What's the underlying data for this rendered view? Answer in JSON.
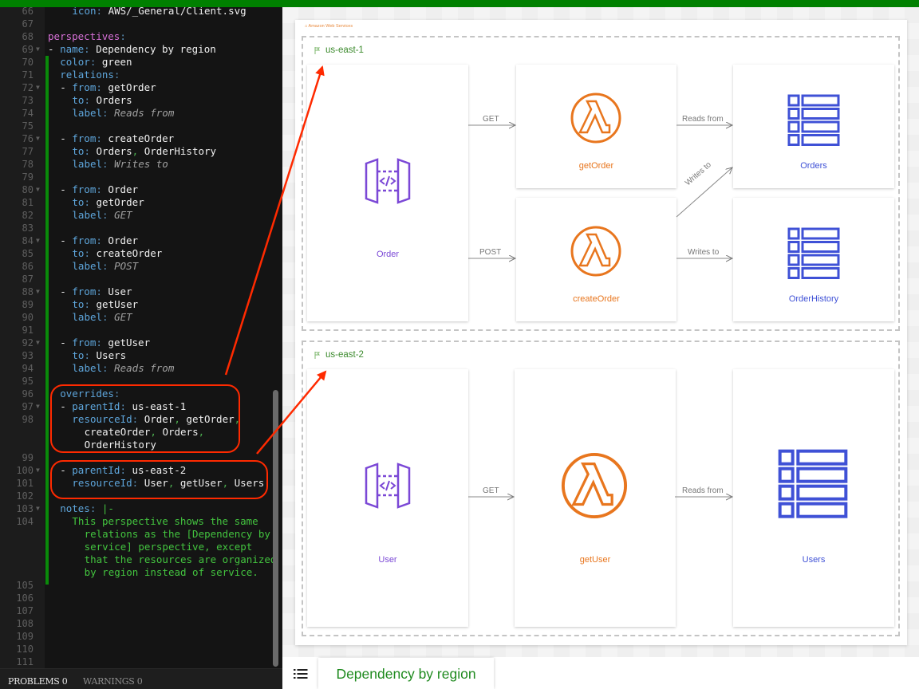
{
  "editor": {
    "lines": [
      {
        "n": "66",
        "fold": false,
        "indent": 4,
        "parts": [
          [
            "k",
            "icon"
          ],
          [
            "p",
            ": "
          ],
          [
            "v",
            "AWS/_General/Client.svg"
          ]
        ]
      },
      {
        "n": "67",
        "fold": false,
        "indent": 0,
        "parts": []
      },
      {
        "n": "68",
        "fold": false,
        "indent": 0,
        "parts": [
          [
            "k-mag",
            "perspectives"
          ],
          [
            "p",
            ":"
          ]
        ]
      },
      {
        "n": "69",
        "fold": true,
        "indent": 0,
        "parts": [
          [
            "v",
            "- "
          ],
          [
            "k",
            "name"
          ],
          [
            "p",
            ": "
          ],
          [
            "v",
            "Dependency by region"
          ]
        ]
      },
      {
        "n": "70",
        "fold": false,
        "indent": 2,
        "parts": [
          [
            "k",
            "color"
          ],
          [
            "p",
            ": "
          ],
          [
            "v",
            "green"
          ]
        ]
      },
      {
        "n": "71",
        "fold": false,
        "indent": 2,
        "parts": [
          [
            "k",
            "relations"
          ],
          [
            "p",
            ":"
          ]
        ]
      },
      {
        "n": "72",
        "fold": true,
        "indent": 2,
        "parts": [
          [
            "v",
            "- "
          ],
          [
            "k",
            "from"
          ],
          [
            "p",
            ": "
          ],
          [
            "v",
            "getOrder"
          ]
        ]
      },
      {
        "n": "73",
        "fold": false,
        "indent": 4,
        "parts": [
          [
            "k",
            "to"
          ],
          [
            "p",
            ": "
          ],
          [
            "v",
            "Orders"
          ]
        ]
      },
      {
        "n": "74",
        "fold": false,
        "indent": 4,
        "parts": [
          [
            "k",
            "label"
          ],
          [
            "p",
            ": "
          ],
          [
            "it",
            "Reads from"
          ]
        ]
      },
      {
        "n": "75",
        "fold": false,
        "indent": 0,
        "parts": []
      },
      {
        "n": "76",
        "fold": true,
        "indent": 2,
        "parts": [
          [
            "v",
            "- "
          ],
          [
            "k",
            "from"
          ],
          [
            "p",
            ": "
          ],
          [
            "v",
            "createOrder"
          ]
        ]
      },
      {
        "n": "77",
        "fold": false,
        "indent": 4,
        "parts": [
          [
            "k",
            "to"
          ],
          [
            "p",
            ": "
          ],
          [
            "v",
            "Orders"
          ],
          [
            "cm",
            ", "
          ],
          [
            "v",
            "OrderHistory"
          ]
        ]
      },
      {
        "n": "78",
        "fold": false,
        "indent": 4,
        "parts": [
          [
            "k",
            "label"
          ],
          [
            "p",
            ": "
          ],
          [
            "it",
            "Writes to"
          ]
        ]
      },
      {
        "n": "79",
        "fold": false,
        "indent": 0,
        "parts": []
      },
      {
        "n": "80",
        "fold": true,
        "indent": 2,
        "parts": [
          [
            "v",
            "- "
          ],
          [
            "k",
            "from"
          ],
          [
            "p",
            ": "
          ],
          [
            "v",
            "Order"
          ]
        ]
      },
      {
        "n": "81",
        "fold": false,
        "indent": 4,
        "parts": [
          [
            "k",
            "to"
          ],
          [
            "p",
            ": "
          ],
          [
            "v",
            "getOrder"
          ]
        ]
      },
      {
        "n": "82",
        "fold": false,
        "indent": 4,
        "parts": [
          [
            "k",
            "label"
          ],
          [
            "p",
            ": "
          ],
          [
            "it",
            "GET"
          ]
        ]
      },
      {
        "n": "83",
        "fold": false,
        "indent": 0,
        "parts": []
      },
      {
        "n": "84",
        "fold": true,
        "indent": 2,
        "parts": [
          [
            "v",
            "- "
          ],
          [
            "k",
            "from"
          ],
          [
            "p",
            ": "
          ],
          [
            "v",
            "Order"
          ]
        ]
      },
      {
        "n": "85",
        "fold": false,
        "indent": 4,
        "parts": [
          [
            "k",
            "to"
          ],
          [
            "p",
            ": "
          ],
          [
            "v",
            "createOrder"
          ]
        ]
      },
      {
        "n": "86",
        "fold": false,
        "indent": 4,
        "parts": [
          [
            "k",
            "label"
          ],
          [
            "p",
            ": "
          ],
          [
            "it",
            "POST"
          ]
        ]
      },
      {
        "n": "87",
        "fold": false,
        "indent": 0,
        "parts": []
      },
      {
        "n": "88",
        "fold": true,
        "indent": 2,
        "parts": [
          [
            "v",
            "- "
          ],
          [
            "k",
            "from"
          ],
          [
            "p",
            ": "
          ],
          [
            "v",
            "User"
          ]
        ]
      },
      {
        "n": "89",
        "fold": false,
        "indent": 4,
        "parts": [
          [
            "k",
            "to"
          ],
          [
            "p",
            ": "
          ],
          [
            "v",
            "getUser"
          ]
        ]
      },
      {
        "n": "90",
        "fold": false,
        "indent": 4,
        "parts": [
          [
            "k",
            "label"
          ],
          [
            "p",
            ": "
          ],
          [
            "it",
            "GET"
          ]
        ]
      },
      {
        "n": "91",
        "fold": false,
        "indent": 0,
        "parts": []
      },
      {
        "n": "92",
        "fold": true,
        "indent": 2,
        "parts": [
          [
            "v",
            "- "
          ],
          [
            "k",
            "from"
          ],
          [
            "p",
            ": "
          ],
          [
            "v",
            "getUser"
          ]
        ]
      },
      {
        "n": "93",
        "fold": false,
        "indent": 4,
        "parts": [
          [
            "k",
            "to"
          ],
          [
            "p",
            ": "
          ],
          [
            "v",
            "Users"
          ]
        ]
      },
      {
        "n": "94",
        "fold": false,
        "indent": 4,
        "parts": [
          [
            "k",
            "label"
          ],
          [
            "p",
            ": "
          ],
          [
            "it",
            "Reads from"
          ]
        ]
      },
      {
        "n": "95",
        "fold": false,
        "indent": 0,
        "parts": []
      },
      {
        "n": "96",
        "fold": false,
        "indent": 2,
        "parts": [
          [
            "k",
            "overrides"
          ],
          [
            "p",
            ":"
          ]
        ]
      },
      {
        "n": "97",
        "fold": true,
        "indent": 2,
        "parts": [
          [
            "v",
            "- "
          ],
          [
            "k",
            "parentId"
          ],
          [
            "p",
            ": "
          ],
          [
            "v",
            "us-east-1"
          ]
        ]
      },
      {
        "n": "98",
        "fold": false,
        "indent": 4,
        "parts": [
          [
            "k",
            "resourceId"
          ],
          [
            "p",
            ": "
          ],
          [
            "v",
            "Order"
          ],
          [
            "cm",
            ", "
          ],
          [
            "v",
            "getOrder"
          ],
          [
            "cm",
            ","
          ]
        ]
      },
      {
        "n": "",
        "fold": false,
        "indent": 6,
        "parts": [
          [
            "v",
            "createOrder"
          ],
          [
            "cm",
            ", "
          ],
          [
            "v",
            "Orders"
          ],
          [
            "cm",
            ","
          ]
        ]
      },
      {
        "n": "",
        "fold": false,
        "indent": 6,
        "parts": [
          [
            "v",
            "OrderHistory"
          ]
        ]
      },
      {
        "n": "99",
        "fold": false,
        "indent": 0,
        "parts": []
      },
      {
        "n": "100",
        "fold": true,
        "indent": 2,
        "parts": [
          [
            "v",
            "- "
          ],
          [
            "k",
            "parentId"
          ],
          [
            "p",
            ": "
          ],
          [
            "v",
            "us-east-2"
          ]
        ]
      },
      {
        "n": "101",
        "fold": false,
        "indent": 4,
        "parts": [
          [
            "k",
            "resourceId"
          ],
          [
            "p",
            ": "
          ],
          [
            "v",
            "User"
          ],
          [
            "cm",
            ", "
          ],
          [
            "v",
            "getUser"
          ],
          [
            "cm",
            ", "
          ],
          [
            "v",
            "Users"
          ]
        ]
      },
      {
        "n": "102",
        "fold": false,
        "indent": 0,
        "parts": []
      },
      {
        "n": "103",
        "fold": true,
        "indent": 2,
        "parts": [
          [
            "k",
            "notes"
          ],
          [
            "p",
            ": "
          ],
          [
            "st",
            "|-"
          ]
        ]
      },
      {
        "n": "104",
        "fold": false,
        "indent": 4,
        "parts": [
          [
            "st",
            "This perspective shows the same"
          ]
        ]
      },
      {
        "n": "",
        "fold": false,
        "indent": 6,
        "parts": [
          [
            "st",
            "relations as the [Dependency by"
          ]
        ]
      },
      {
        "n": "",
        "fold": false,
        "indent": 6,
        "parts": [
          [
            "st",
            "service] perspective, except"
          ]
        ]
      },
      {
        "n": "",
        "fold": false,
        "indent": 6,
        "parts": [
          [
            "st",
            "that the resources are organized"
          ]
        ]
      },
      {
        "n": "",
        "fold": false,
        "indent": 6,
        "parts": [
          [
            "st",
            "by region instead of service."
          ]
        ]
      },
      {
        "n": "105",
        "fold": false,
        "indent": 0,
        "parts": []
      },
      {
        "n": "106",
        "fold": false,
        "indent": 0,
        "parts": []
      },
      {
        "n": "107",
        "fold": false,
        "indent": 0,
        "parts": []
      },
      {
        "n": "108",
        "fold": false,
        "indent": 0,
        "parts": []
      },
      {
        "n": "109",
        "fold": false,
        "indent": 0,
        "parts": []
      },
      {
        "n": "110",
        "fold": false,
        "indent": 0,
        "parts": []
      },
      {
        "n": "111",
        "fold": false,
        "indent": 0,
        "parts": []
      }
    ]
  },
  "status": {
    "problems": "PROBLEMS 0",
    "warnings": "WARNINGS 0"
  },
  "diagram": {
    "provider_label": "Amazon Web Services",
    "regions": [
      {
        "id": "us-east-1",
        "title": "us-east-1"
      },
      {
        "id": "us-east-2",
        "title": "us-east-2"
      }
    ],
    "nodes": {
      "order": {
        "label": "Order",
        "type": "api-gateway"
      },
      "getOrder": {
        "label": "getOrder",
        "type": "lambda"
      },
      "createOrder": {
        "label": "createOrder",
        "type": "lambda"
      },
      "orders": {
        "label": "Orders",
        "type": "table"
      },
      "orderHistory": {
        "label": "OrderHistory",
        "type": "table"
      },
      "user": {
        "label": "User",
        "type": "api-gateway"
      },
      "getUser": {
        "label": "getUser",
        "type": "lambda"
      },
      "users": {
        "label": "Users",
        "type": "table"
      }
    },
    "edges": {
      "order_getOrder": "GET",
      "order_createOrder": "POST",
      "getOrder_orders": "Reads from",
      "createOrder_orders": "Writes to",
      "createOrder_orderHistory": "Writes to",
      "user_getUser": "GET",
      "getUser_users": "Reads from"
    },
    "colors": {
      "api": "#7b48d6",
      "lambda": "#e8761e",
      "table": "#3f51d6",
      "region": "#3d8b2e",
      "annotation": "#ff2a00"
    }
  },
  "perspective_bar": {
    "active_tab": "Dependency by region"
  }
}
